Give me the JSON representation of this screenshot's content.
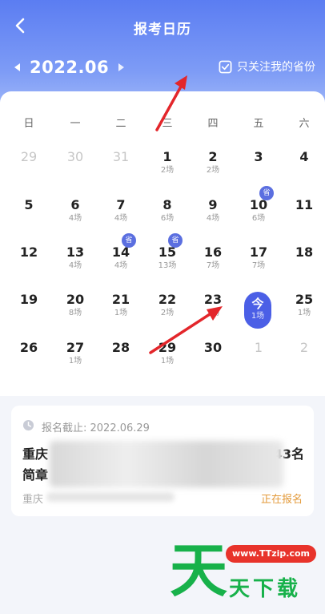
{
  "header": {
    "title": "报考日历",
    "month": "2022.06",
    "filter_label": "只关注我的省份"
  },
  "weekdays": [
    "日",
    "一",
    "二",
    "三",
    "四",
    "五",
    "六"
  ],
  "weeks": [
    [
      {
        "day": "29",
        "sub": "",
        "dim": true
      },
      {
        "day": "30",
        "sub": "",
        "dim": true
      },
      {
        "day": "31",
        "sub": "",
        "dim": true
      },
      {
        "day": "1",
        "sub": "2场"
      },
      {
        "day": "2",
        "sub": "2场"
      },
      {
        "day": "3",
        "sub": ""
      },
      {
        "day": "4",
        "sub": ""
      }
    ],
    [
      {
        "day": "5",
        "sub": ""
      },
      {
        "day": "6",
        "sub": "4场"
      },
      {
        "day": "7",
        "sub": "4场"
      },
      {
        "day": "8",
        "sub": "6场"
      },
      {
        "day": "9",
        "sub": "4场"
      },
      {
        "day": "10",
        "sub": "6场",
        "badge": "省"
      },
      {
        "day": "11",
        "sub": ""
      }
    ],
    [
      {
        "day": "12",
        "sub": ""
      },
      {
        "day": "13",
        "sub": "4场"
      },
      {
        "day": "14",
        "sub": "4场",
        "badge": "省"
      },
      {
        "day": "15",
        "sub": "13场",
        "badge": "省"
      },
      {
        "day": "16",
        "sub": "7场"
      },
      {
        "day": "17",
        "sub": "7场"
      },
      {
        "day": "18",
        "sub": ""
      }
    ],
    [
      {
        "day": "19",
        "sub": ""
      },
      {
        "day": "20",
        "sub": "8场"
      },
      {
        "day": "21",
        "sub": "1场"
      },
      {
        "day": "22",
        "sub": "2场"
      },
      {
        "day": "23",
        "sub": "1场"
      },
      {
        "day": "今",
        "sub": "1场",
        "today": true
      },
      {
        "day": "25",
        "sub": "1场"
      }
    ],
    [
      {
        "day": "26",
        "sub": ""
      },
      {
        "day": "27",
        "sub": "1场"
      },
      {
        "day": "28",
        "sub": ""
      },
      {
        "day": "29",
        "sub": "1场"
      },
      {
        "day": "30",
        "sub": ""
      },
      {
        "day": "1",
        "sub": "",
        "dim": true
      },
      {
        "day": "2",
        "sub": "",
        "dim": true
      }
    ]
  ],
  "notice": {
    "deadline": "报名截止: 2022.06.29",
    "title_start": "重庆",
    "title_end": "43名",
    "title_line2": "简章",
    "region": "重庆",
    "status": "正在报名"
  },
  "watermark": {
    "big": "天",
    "rest": "天下载",
    "url": "www.TTzip.com"
  },
  "colors": {
    "accent": "#4b5fe6",
    "status": "#e39a3a",
    "arrow": "#e3262b"
  }
}
